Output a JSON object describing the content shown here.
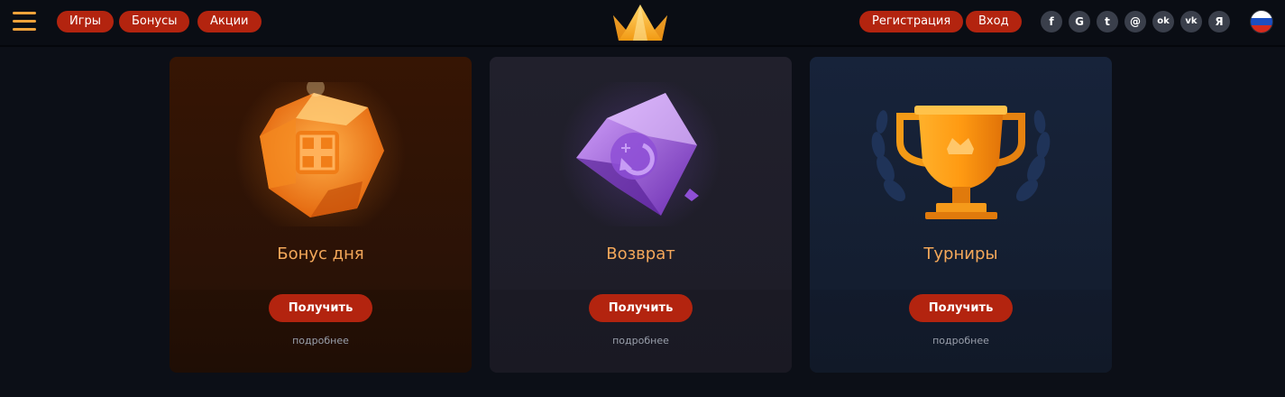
{
  "header": {
    "nav": [
      "Игры",
      "Бонусы",
      "Акции"
    ],
    "register_label": "Регистрация",
    "login_label": "Вход",
    "socials": [
      {
        "icon": "facebook-icon",
        "glyph": "f"
      },
      {
        "icon": "google-icon",
        "glyph": "G"
      },
      {
        "icon": "twitter-icon",
        "glyph": "t"
      },
      {
        "icon": "mail-icon",
        "glyph": "@"
      },
      {
        "icon": "odnoklassniki-icon",
        "glyph": "ok"
      },
      {
        "icon": "vk-icon",
        "glyph": "vk"
      },
      {
        "icon": "yandex-icon",
        "glyph": "Я"
      }
    ],
    "accent_color": "#b3240f"
  },
  "cards": [
    {
      "title": "Бонус дня",
      "button": "Получить",
      "link": "подробнее"
    },
    {
      "title": "Возврат",
      "button": "Получить",
      "link": "подробнее"
    },
    {
      "title": "Турниры",
      "button": "Получить",
      "link": "подробнее"
    }
  ]
}
